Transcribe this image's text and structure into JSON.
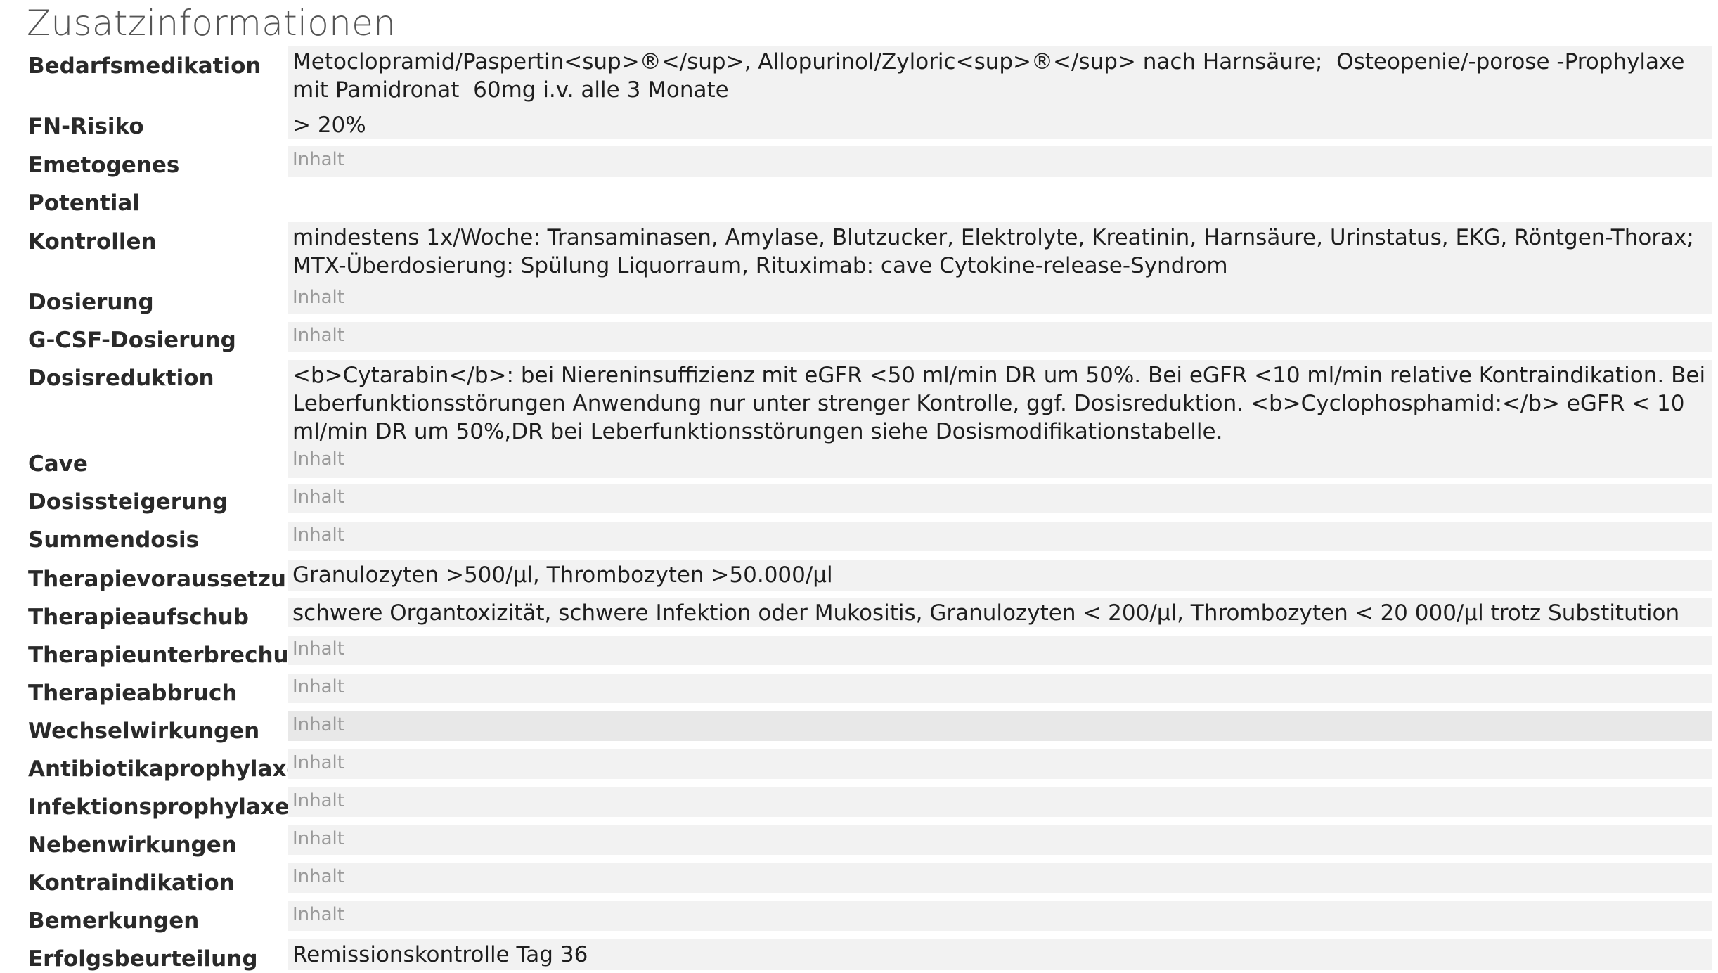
{
  "section": {
    "title": "Zusatzinformationen"
  },
  "placeholder": "Inhalt",
  "fields": {
    "bedarfsmedikation": {
      "label": "Bedarfsmedikation",
      "value": "Metoclopramid/Paspertin<sup>®</sup>, Allopurinol/Zyloric<sup>®</sup> nach Harnsäure;  Osteopenie/-porose -Prophylaxe mit Pamidronat  60mg i.v. alle 3 Monate"
    },
    "fn_risiko": {
      "label": "FN-Risiko",
      "value": "> 20%"
    },
    "emetogenes_potential": {
      "label": "Emetogenes Potential",
      "value": ""
    },
    "kontrollen": {
      "label": "Kontrollen",
      "value": "mindestens 1x/Woche: Transaminasen, Amylase, Blutzucker, Elektrolyte, Kreatinin, Harnsäure, Urinstatus, EKG, Röntgen-Thorax; MTX-Überdosierung: Spülung Liquorraum, Rituximab: cave Cytokine-release-Syndrom"
    },
    "dosierung": {
      "label": "Dosierung",
      "value": ""
    },
    "gcsf_dosierung": {
      "label": "G-CSF-Dosierung",
      "value": ""
    },
    "dosisreduktion": {
      "label": "Dosisreduktion",
      "value": "<b>Cytarabin</b>: bei Niereninsuffizienz mit eGFR <50 ml/min DR um 50%. Bei eGFR <10 ml/min relative Kontraindikation. Bei Leberfunktionsstörungen Anwendung nur unter strenger Kontrolle, ggf. Dosisreduktion. <b>Cyclophosphamid:</b> eGFR < 10 ml/min DR um 50%,DR bei Leberfunktionsstörungen siehe Dosismodifikationstabelle."
    },
    "cave": {
      "label": "Cave",
      "value": ""
    },
    "dosissteigerung": {
      "label": "Dosissteigerung",
      "value": ""
    },
    "summendosis": {
      "label": "Summendosis",
      "value": ""
    },
    "therapievoraussetzung": {
      "label": "Therapievoraussetzung",
      "value": "Granulozyten >500/µl, Thrombozyten >50.000/µl"
    },
    "therapieaufschub": {
      "label": "Therapieaufschub",
      "value": "schwere Organtoxizität, schwere Infektion oder Mukositis, Granulozyten < 200/µl, Thrombozyten < 20 000/µl trotz Substitution"
    },
    "therapieunterbrechung": {
      "label": "Therapieunterbrechung",
      "value": ""
    },
    "therapieabbruch": {
      "label": "Therapieabbruch",
      "value": ""
    },
    "wechselwirkungen": {
      "label": "Wechselwirkungen",
      "value": ""
    },
    "antibiotikaprophylaxe": {
      "label": "Antibiotikaprophylaxe",
      "value": ""
    },
    "infektionsprophylaxe": {
      "label": "Infektionsprophylaxe",
      "value": ""
    },
    "nebenwirkungen": {
      "label": "Nebenwirkungen",
      "value": ""
    },
    "kontraindikation": {
      "label": "Kontraindikation",
      "value": ""
    },
    "bemerkungen": {
      "label": "Bemerkungen",
      "value": ""
    },
    "erfolgsbeurteilung": {
      "label": "Erfolgsbeurteilung",
      "value": "Remissionskontrolle Tag 36"
    }
  }
}
